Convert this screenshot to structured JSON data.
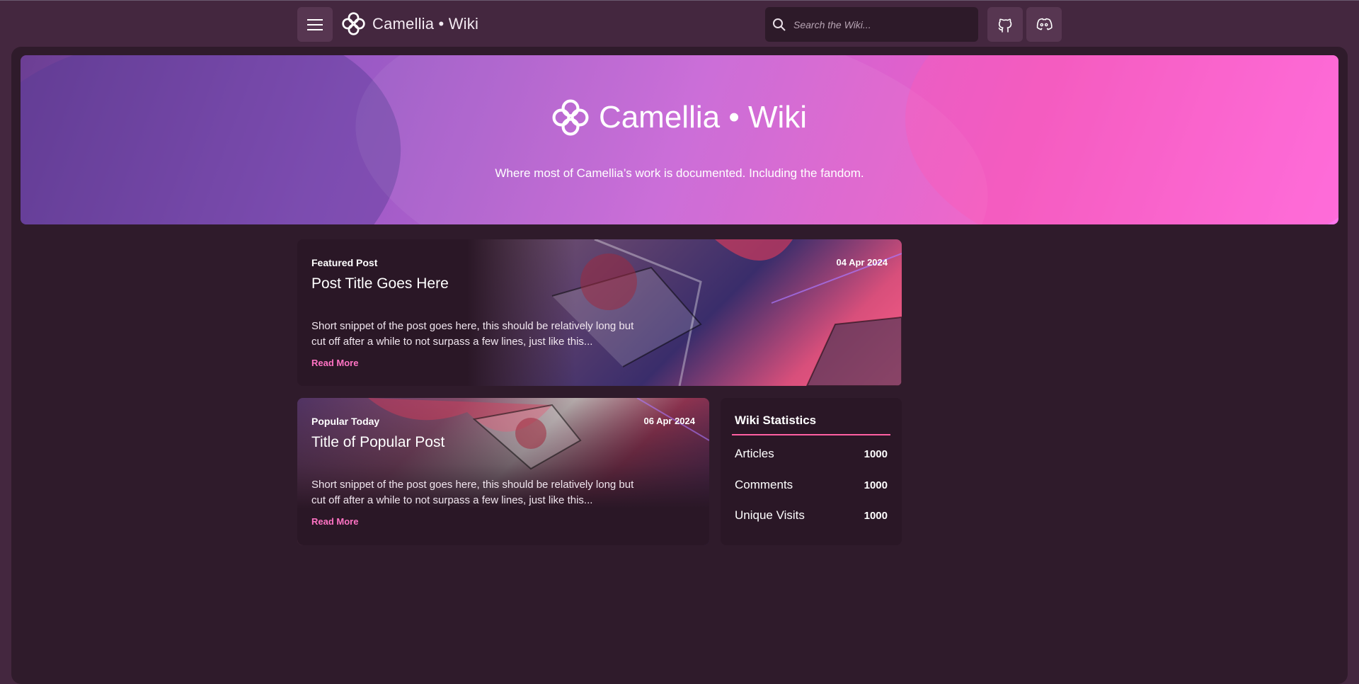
{
  "header": {
    "brand": "Camellia • Wiki",
    "search_placeholder": "Search the Wiki..."
  },
  "hero": {
    "title": "Camellia • Wiki",
    "subtitle": "Where most of Camellia’s work is documented. Including the fandom."
  },
  "featured": {
    "label": "Featured Post",
    "date": "04 Apr 2024",
    "title": "Post Title Goes Here",
    "snippet": "Short snippet of the post goes here, this should be relatively long but cut off after a while to not surpass a few lines, just like this...",
    "read_more": "Read More"
  },
  "popular": {
    "label": "Popular Today",
    "date": "06 Apr 2024",
    "title": "Title of Popular Post",
    "snippet": "Short snippet of the post goes here, this should be relatively long but cut off after a while to not surpass a few lines, just like this...",
    "read_more": "Read More"
  },
  "stats": {
    "title": "Wiki Statistics",
    "rows": [
      {
        "name": "Articles",
        "value": "1000"
      },
      {
        "name": "Comments",
        "value": "1000"
      },
      {
        "name": "Unique Visits",
        "value": "1000"
      }
    ]
  },
  "icons": {
    "menu": "hamburger-icon",
    "logo": "camellia-flower-logo",
    "search": "search-icon",
    "github": "github-icon",
    "discord": "discord-icon"
  },
  "colors": {
    "background": "#44273f",
    "panel": "#2f1b2b",
    "accent": "#ff73c4"
  }
}
